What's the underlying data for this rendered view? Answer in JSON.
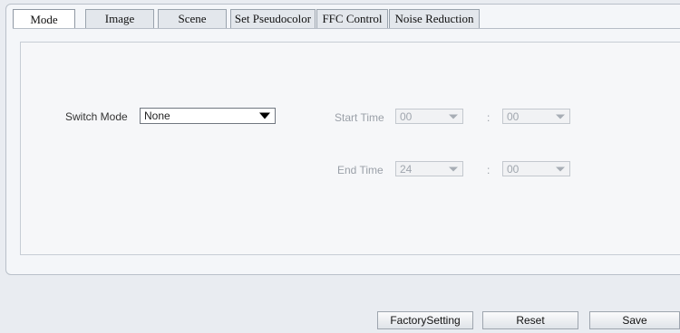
{
  "tabs": [
    {
      "label": "Mode"
    },
    {
      "label": "Image"
    },
    {
      "label": "Scene"
    },
    {
      "label": "Set Pseudocolor"
    },
    {
      "label": "FFC Control"
    },
    {
      "label": "Noise Reduction"
    }
  ],
  "active_tab": "Mode",
  "form": {
    "switch_mode_label": "Switch Mode",
    "switch_mode_value": "None",
    "start_time_label": "Start Time",
    "start_hour": "00",
    "start_minute": "00",
    "end_time_label": "End Time",
    "end_hour": "24",
    "end_minute": "00",
    "separator": ":"
  },
  "buttons": {
    "factory_label": "FactorySetting",
    "reset_label": "Reset",
    "save_label": "Save"
  },
  "icons": {
    "dropdown": "chevron-down-icon"
  }
}
